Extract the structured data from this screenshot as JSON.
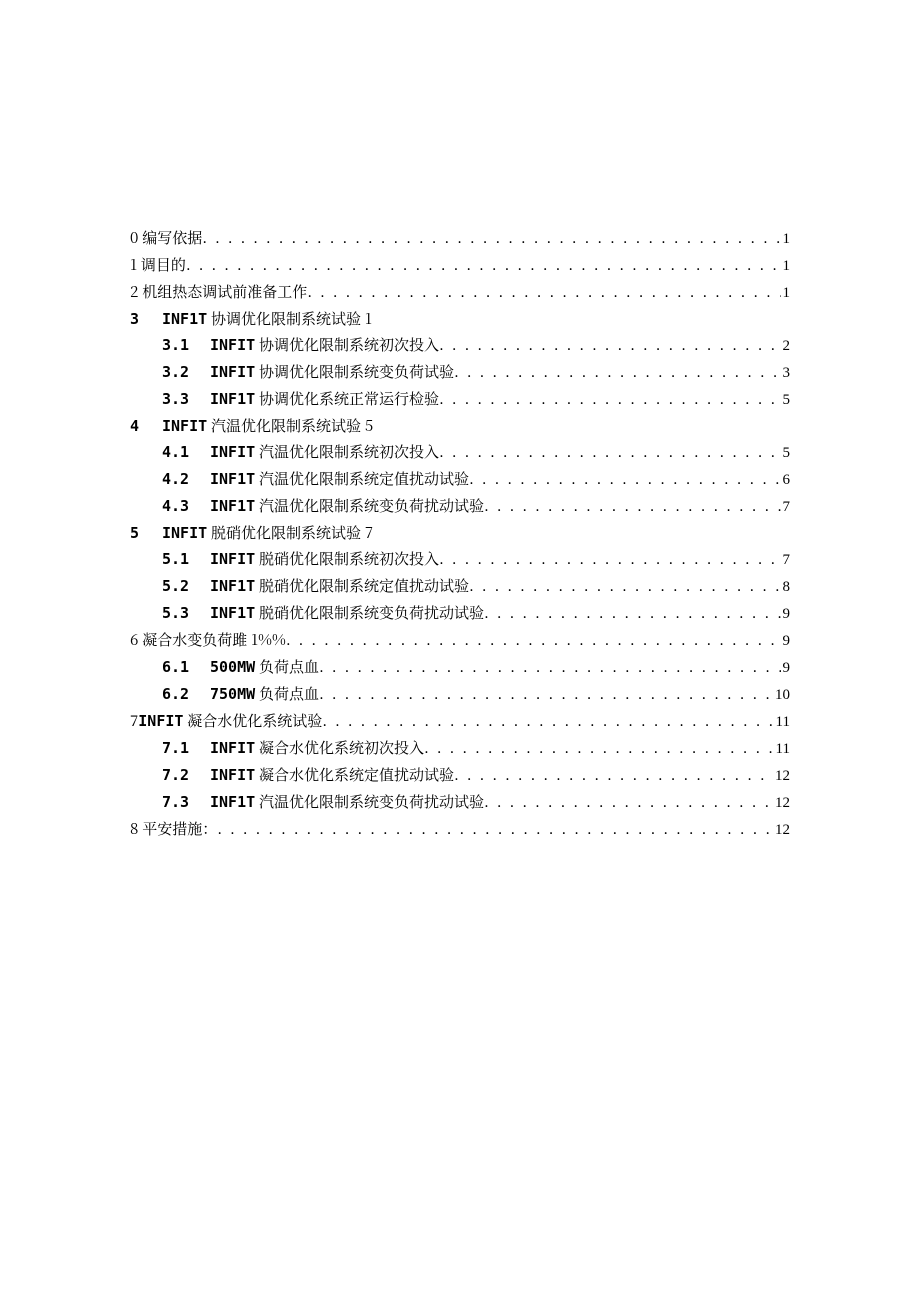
{
  "rows": [
    {
      "type": "top",
      "num": "0",
      "title": "编写依据",
      "pg": "1"
    },
    {
      "type": "top",
      "num": "1",
      "title": "调目的",
      "pg": "1"
    },
    {
      "type": "top",
      "num": "2",
      "title": "机组热态调试前准备工作",
      "pg": "1"
    },
    {
      "type": "heading",
      "num": "3",
      "mono": "INF1T",
      "tail": " 协调优化限制系统试验 1"
    },
    {
      "type": "sub",
      "num": "3.1",
      "mono": "INFIT",
      "tail": " 协调优化限制系统初次投入",
      "pg": "2"
    },
    {
      "type": "sub",
      "num": "3.2",
      "mono": "INFIT",
      "tail": " 协调优化限制系统变负荷试验",
      "pg": "3"
    },
    {
      "type": "sub",
      "num": "3.3",
      "mono": "INF1T",
      "tail": " 协调优化系统正常运行检验",
      "pg": "5"
    },
    {
      "type": "heading",
      "num": "4",
      "mono": "INFIT",
      "tail": " 汽温优化限制系统试验 5"
    },
    {
      "type": "sub",
      "num": "4.1",
      "mono": "INFIT",
      "tail": " 汽温优化限制系统初次投入",
      "pg": "5"
    },
    {
      "type": "sub",
      "num": "4.2",
      "mono": "INF1T",
      "tail": " 汽温优化限制系统定值扰动试验",
      "pg": "6"
    },
    {
      "type": "sub",
      "num": "4.3",
      "mono": "INF1T",
      "tail": " 汽温优化限制系统变负荷扰动试验",
      "pg": "7"
    },
    {
      "type": "heading",
      "num": "5",
      "mono": "INFIT",
      "tail": " 脱硝优化限制系统试验 7"
    },
    {
      "type": "sub",
      "num": "5.1",
      "mono": "INFIT",
      "tail": " 脱硝优化限制系统初次投入",
      "pg": "7"
    },
    {
      "type": "sub",
      "num": "5.2",
      "mono": "INF1T",
      "tail": " 脱硝优化限制系统定值扰动试验",
      "pg": "8"
    },
    {
      "type": "sub",
      "num": "5.3",
      "mono": "INF1T",
      "tail": " 脱硝优化限制系统变负荷扰动试验",
      "pg": "9"
    },
    {
      "type": "top",
      "num": "6",
      "title": "凝合水变负荷雎 1%%",
      "pg": "9"
    },
    {
      "type": "sub",
      "num": "6.1",
      "mono": "500MW",
      "tail": " 负荷点血",
      "pg": "9"
    },
    {
      "type": "sub",
      "num": "6.2",
      "mono": "750MW",
      "tail": " 负荷点血",
      "pg": "10"
    },
    {
      "type": "topmono",
      "num": "7",
      "mono": "INFIT",
      "tail": " 凝合水优化系统试验",
      "pg": "11"
    },
    {
      "type": "sub",
      "num": "7.1",
      "mono": "INFIT",
      "tail": " 凝合水优化系统初次投入",
      "pg": "11"
    },
    {
      "type": "sub",
      "num": "7.2",
      "mono": "INFIT",
      "tail": " 凝合水优化系统定值扰动试验",
      "pg": "12"
    },
    {
      "type": "sub",
      "num": "7.3",
      "mono": "INF1T",
      "tail": " 汽温优化限制系统变负荷扰动试验",
      "pg": "12"
    },
    {
      "type": "top",
      "num": "8",
      "title": "平安措施：",
      "pg": "12"
    }
  ],
  "dots": ". . . . . . . . . . . . . . . . . . . . . . . . . . . . . . . . . . . . . . . . . . . . . . . . . . . . . . . . . . . . . . . . . . . . . . . . . . . . . . . . . . . . . . . . . . . . . . . . . . . . . . . . . . . . . . . . . . . . . . . . . . . . . . . . . . . . . ."
}
